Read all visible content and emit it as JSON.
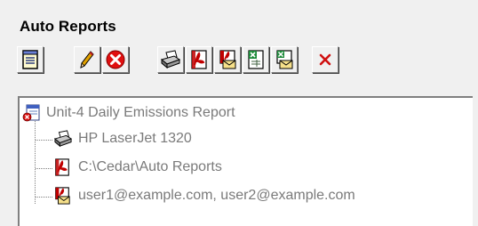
{
  "panel": {
    "title": "Auto Reports"
  },
  "toolbar": {
    "buttons": [
      {
        "name": "view-report-button",
        "icon": "notepad-icon"
      },
      {
        "name": "edit-button",
        "icon": "pencil-icon"
      },
      {
        "name": "delete-button",
        "icon": "red-x-circle-icon"
      },
      {
        "name": "print-button",
        "icon": "printer-icon"
      },
      {
        "name": "save-pdf-button",
        "icon": "pdf-save-icon"
      },
      {
        "name": "email-pdf-button",
        "icon": "pdf-email-icon"
      },
      {
        "name": "save-excel-button",
        "icon": "excel-save-icon"
      },
      {
        "name": "email-excel-button",
        "icon": "excel-email-icon"
      },
      {
        "name": "cancel-button",
        "icon": "red-x-icon"
      }
    ]
  },
  "tree": {
    "root": {
      "label": "Unit-4 Daily Emissions Report",
      "icon": "report-icon"
    },
    "children": [
      {
        "label": "HP LaserJet 1320",
        "icon": "printer-icon"
      },
      {
        "label": "C:\\Cedar\\Auto Reports",
        "icon": "pdf-icon"
      },
      {
        "label": "user1@example.com, user2@example.com",
        "icon": "pdf-email-icon"
      }
    ]
  }
}
